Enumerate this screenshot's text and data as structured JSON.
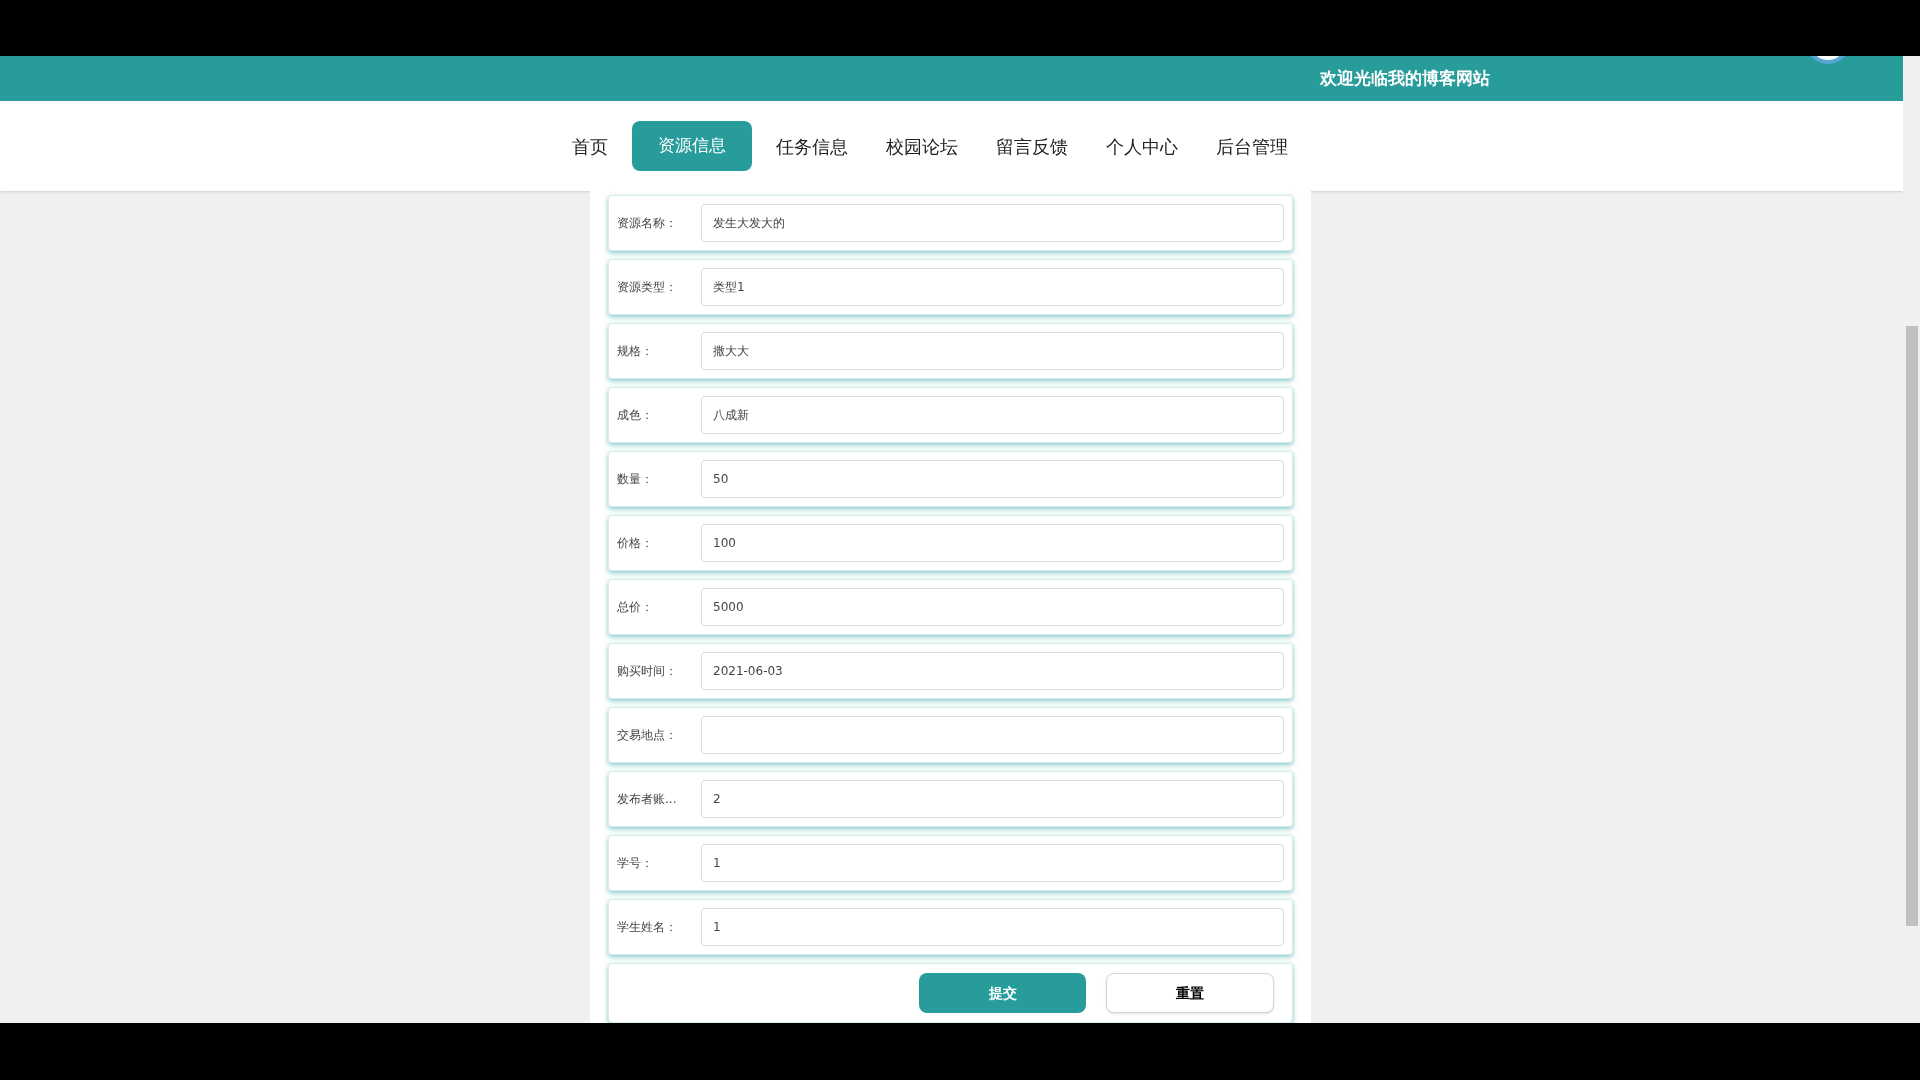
{
  "header": {
    "greeting": "欢迎光临我的博客网站"
  },
  "nav": [
    {
      "label": "首页",
      "selected": false
    },
    {
      "label": "资源信息",
      "selected": true
    },
    {
      "label": "任务信息",
      "selected": false
    },
    {
      "label": "校园论坛",
      "selected": false
    },
    {
      "label": "留言反馈",
      "selected": false
    },
    {
      "label": "个人中心",
      "selected": false
    },
    {
      "label": "后台管理",
      "selected": false
    }
  ],
  "form": {
    "fields": [
      {
        "label": "资源名称：",
        "value": "发生大发大的"
      },
      {
        "label": "资源类型：",
        "value": "类型1"
      },
      {
        "label": "规格：",
        "value": "撒大大"
      },
      {
        "label": "成色：",
        "value": "八成新"
      },
      {
        "label": "数量：",
        "value": "50"
      },
      {
        "label": "价格：",
        "value": "100"
      },
      {
        "label": "总价：",
        "value": "5000"
      },
      {
        "label": "购买时间：",
        "value": "2021-06-03"
      },
      {
        "label": "交易地点："
      },
      {
        "label": "发布者账...",
        "value": "2"
      },
      {
        "label": "学号：",
        "value": "1"
      },
      {
        "label": "学生姓名：",
        "value": "1"
      }
    ],
    "buttons": [
      {
        "label": "提交",
        "kind": "primary"
      },
      {
        "label": "重置",
        "kind": "secondary"
      }
    ]
  }
}
